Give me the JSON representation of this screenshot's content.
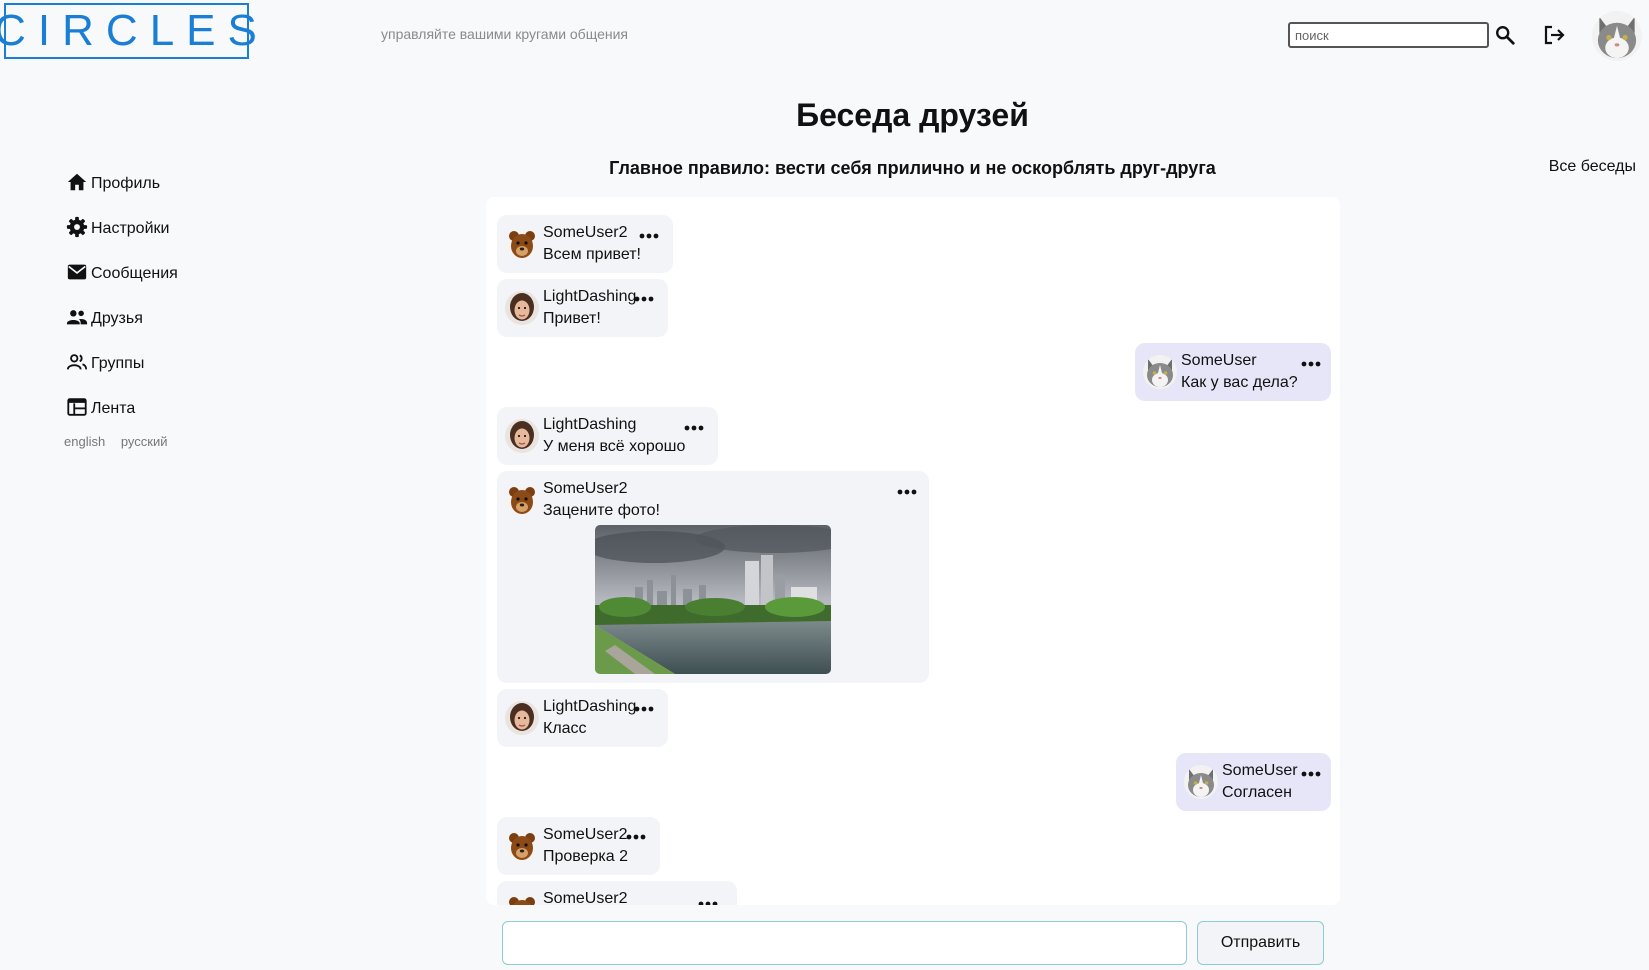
{
  "header": {
    "logo_text": "CIRCLES",
    "tagline": "управляйте вашими кругами общения",
    "search_placeholder": "поиск",
    "search_value": "",
    "icons": [
      "search-icon",
      "logout-icon"
    ]
  },
  "sidebar": {
    "items": [
      {
        "label": "Профиль",
        "icon": "home-icon"
      },
      {
        "label": "Настройки",
        "icon": "gear-icon"
      },
      {
        "label": "Сообщения",
        "icon": "mail-icon"
      },
      {
        "label": "Друзья",
        "icon": "people-icon"
      },
      {
        "label": "Группы",
        "icon": "group-outline-icon"
      },
      {
        "label": "Лента",
        "icon": "feed-icon"
      }
    ],
    "languages": [
      "english",
      "русский"
    ]
  },
  "main": {
    "title": "Беседа друзей",
    "rule": "Главное правило: вести себя прилично и не оскорблять друг-друга",
    "all_chats_link": "Все беседы"
  },
  "messages": [
    {
      "author": "SomeUser2",
      "text": "Всем привет!",
      "mine": false
    },
    {
      "author": "LightDashing",
      "text": "Привет!",
      "mine": false
    },
    {
      "author": "SomeUser",
      "text": "Как у вас дела?",
      "mine": true
    },
    {
      "author": "LightDashing",
      "text": "У меня всё хорошо",
      "mine": false
    },
    {
      "author": "SomeUser2",
      "text": "Зацените фото!",
      "mine": false,
      "has_photo": true
    },
    {
      "author": "LightDashing",
      "text": "Класс",
      "mine": false
    },
    {
      "author": "SomeUser",
      "text": "Согласен",
      "mine": true
    },
    {
      "author": "SomeUser2",
      "text": "Проверка 2",
      "mine": false
    },
    {
      "author": "SomeUser2",
      "text": "",
      "mine": false
    }
  ],
  "composer": {
    "value": "",
    "send_label": "Отправить"
  },
  "colors": {
    "brand": "#1a7fd4",
    "bubble_other": "#f3f4f7",
    "bubble_mine": "#e6e6f8"
  }
}
